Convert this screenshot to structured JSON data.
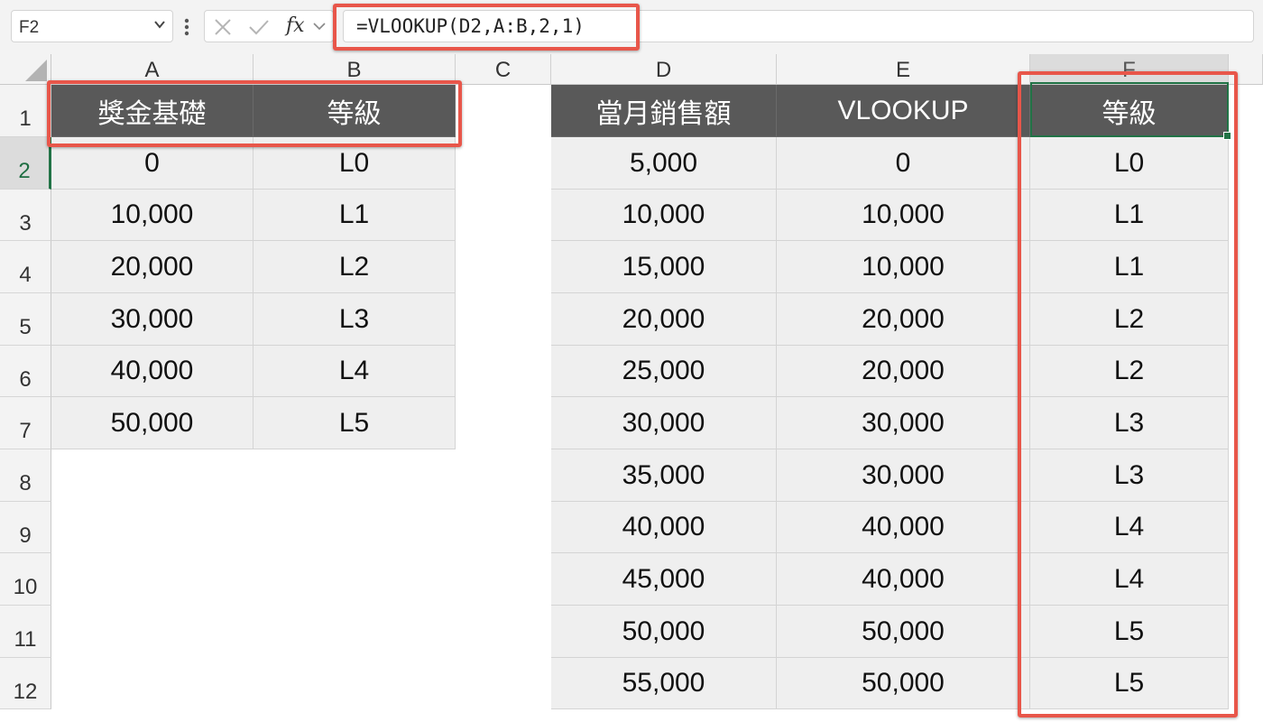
{
  "formula_bar": {
    "name_box": "F2",
    "formula": "=VLOOKUP(D2,A:B,2,1)",
    "fx_label": "fx",
    "cancel_icon": "close-icon",
    "enter_icon": "check-icon"
  },
  "columns": [
    "A",
    "B",
    "C",
    "D",
    "E",
    "F"
  ],
  "rows": [
    "1",
    "2",
    "3",
    "4",
    "5",
    "6",
    "7",
    "8",
    "9",
    "10",
    "11",
    "12"
  ],
  "selected_cell": "F2",
  "table_left": {
    "headers": [
      "獎金基礎",
      "等級"
    ],
    "rows": [
      [
        "0",
        "L0"
      ],
      [
        "10,000",
        "L1"
      ],
      [
        "20,000",
        "L2"
      ],
      [
        "30,000",
        "L3"
      ],
      [
        "40,000",
        "L4"
      ],
      [
        "50,000",
        "L5"
      ]
    ]
  },
  "table_right": {
    "headers": [
      "當月銷售額",
      "VLOOKUP",
      "等級"
    ],
    "rows": [
      [
        "5,000",
        "0",
        "L0"
      ],
      [
        "10,000",
        "10,000",
        "L1"
      ],
      [
        "15,000",
        "10,000",
        "L1"
      ],
      [
        "20,000",
        "20,000",
        "L2"
      ],
      [
        "25,000",
        "20,000",
        "L2"
      ],
      [
        "30,000",
        "30,000",
        "L3"
      ],
      [
        "35,000",
        "30,000",
        "L3"
      ],
      [
        "40,000",
        "40,000",
        "L4"
      ],
      [
        "45,000",
        "40,000",
        "L4"
      ],
      [
        "50,000",
        "50,000",
        "L5"
      ],
      [
        "55,000",
        "50,000",
        "L5"
      ]
    ]
  },
  "colors": {
    "header_fill": "#595959",
    "cell_fill": "#efefef",
    "highlight": "#e8564a",
    "selection": "#217346"
  }
}
